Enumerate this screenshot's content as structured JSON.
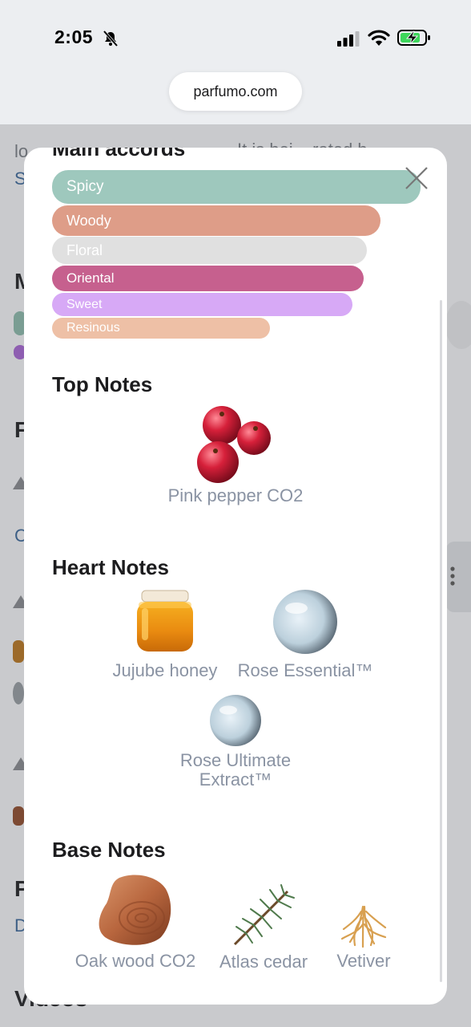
{
  "status_bar": {
    "time": "2:05"
  },
  "browser": {
    "url": "parfumo.com"
  },
  "background": {
    "frag_lo": "lo",
    "frag_it": "It is bei... rated b",
    "frag_s": "S",
    "frag_m": "M",
    "frag_f": "F",
    "frag_c": "C",
    "frag_p": "P",
    "frag_d": "D",
    "frag_video": "Videos"
  },
  "modal": {
    "main_accords_title": "Main accords",
    "accords": [
      {
        "label": "Spicy",
        "color": "#9ec8bd"
      },
      {
        "label": "Woody",
        "color": "#de9d88"
      },
      {
        "label": "Floral",
        "color": "#e0e0e0"
      },
      {
        "label": "Oriental",
        "color": "#c6608e"
      },
      {
        "label": "Sweet",
        "color": "#d7a9f6"
      },
      {
        "label": "Resinous",
        "color": "#eec0a6"
      }
    ],
    "top_notes": {
      "title": "Top Notes",
      "items": [
        "Pink pepper CO2"
      ]
    },
    "heart_notes": {
      "title": "Heart Notes",
      "items": [
        "Jujube honey",
        "Rose Essential™",
        "Rose Ultimate Extract™"
      ]
    },
    "base_notes": {
      "title": "Base Notes",
      "items": [
        "Oak wood CO2",
        "Atlas cedar",
        "Vetiver"
      ]
    }
  }
}
